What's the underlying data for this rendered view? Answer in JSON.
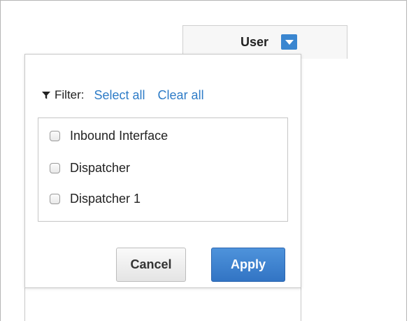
{
  "header": {
    "column_label": "User"
  },
  "filter": {
    "label": "Filter:",
    "select_all": "Select all",
    "clear_all": "Clear all"
  },
  "options": [
    {
      "label": "Inbound Interface",
      "checked": false
    },
    {
      "label": "Dispatcher",
      "checked": false
    },
    {
      "label": "Dispatcher 1",
      "checked": false
    }
  ],
  "buttons": {
    "cancel": "Cancel",
    "apply": "Apply"
  },
  "colors": {
    "accent": "#3a86d0",
    "link": "#2e7cc7",
    "apply_button": "#3a7fd0"
  },
  "icons": {
    "filter": "funnel-icon",
    "dropdown": "caret-down-icon"
  }
}
